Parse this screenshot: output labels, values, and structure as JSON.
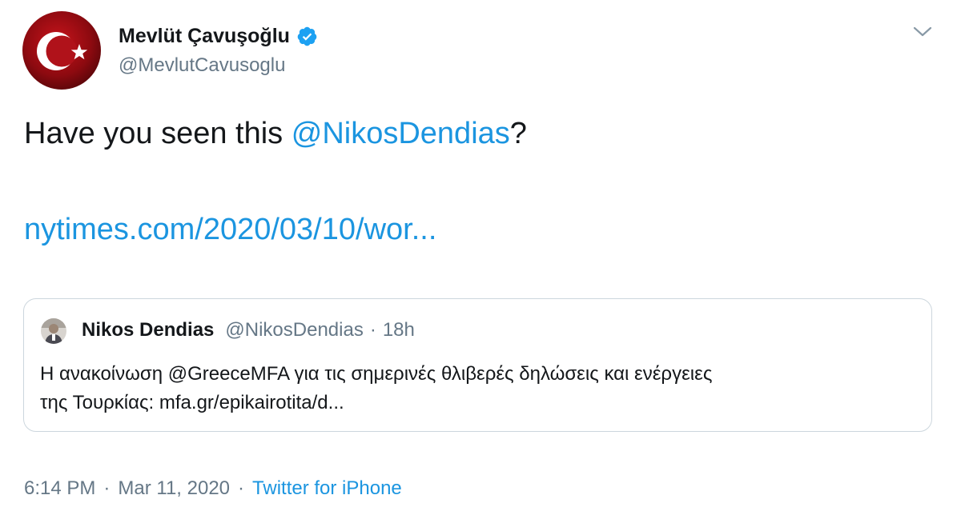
{
  "author": {
    "name": "Mevlüt Çavuşoğlu",
    "handle": "@MevlutCavusoglu",
    "verified": true,
    "avatar_icon": "turkish-flag-avatar"
  },
  "tweet": {
    "text_prefix": "Have you seen this ",
    "mention": "@NikosDendias",
    "text_suffix": "?",
    "link": "nytimes.com/2020/03/10/wor..."
  },
  "quoted_tweet": {
    "name": "Nikos Dendias",
    "handle": "@NikosDendias",
    "separator": "·",
    "time": "18h",
    "text_line1": "Η ανακοίνωση @GreeceMFA για τις σημερινές θλιβερές δηλώσεις και ενέργειες",
    "text_line2": "της Τουρκίας: mfa.gr/epikairotita/d..."
  },
  "footer": {
    "time": "6:14 PM",
    "separator": "·",
    "date": "Mar 11, 2020",
    "separator2": "·",
    "source": "Twitter for iPhone"
  },
  "colors": {
    "link": "#1b95e0",
    "muted": "#657786",
    "text": "#14171a",
    "border": "#ccd6dd",
    "verified": "#1da1f2"
  }
}
